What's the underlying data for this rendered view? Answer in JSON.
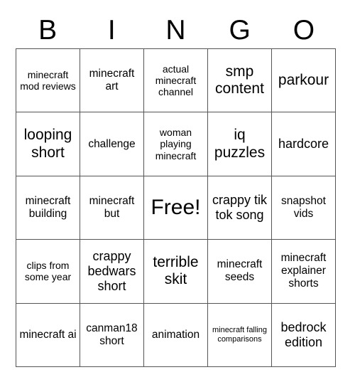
{
  "card": {
    "header_letters": [
      "B",
      "I",
      "N",
      "G",
      "O"
    ],
    "rows": [
      [
        {
          "text": "minecraft mod reviews",
          "size": "sm"
        },
        {
          "text": "minecraft art",
          "size": "md"
        },
        {
          "text": "actual minecraft channel",
          "size": "sm"
        },
        {
          "text": "smp content",
          "size": "xl"
        },
        {
          "text": "parkour",
          "size": "xl"
        }
      ],
      [
        {
          "text": "looping short",
          "size": "xl"
        },
        {
          "text": "challenge",
          "size": "md"
        },
        {
          "text": "woman playing minecraft",
          "size": "sm"
        },
        {
          "text": "iq puzzles",
          "size": "xl"
        },
        {
          "text": "hardcore",
          "size": "lg"
        }
      ],
      [
        {
          "text": "minecraft building",
          "size": "md"
        },
        {
          "text": "minecraft but",
          "size": "md"
        },
        {
          "text": "Free!",
          "size": "xxl"
        },
        {
          "text": "crappy tik tok song",
          "size": "lg"
        },
        {
          "text": "snapshot vids",
          "size": "md"
        }
      ],
      [
        {
          "text": "clips from some year",
          "size": "sm"
        },
        {
          "text": "crappy bedwars short",
          "size": "lg"
        },
        {
          "text": "terrible skit",
          "size": "xl"
        },
        {
          "text": "minecraft seeds",
          "size": "md"
        },
        {
          "text": "minecraft explainer shorts",
          "size": "md"
        }
      ],
      [
        {
          "text": "minecraft ai",
          "size": "md"
        },
        {
          "text": "canman18 short",
          "size": "md"
        },
        {
          "text": "animation",
          "size": "md"
        },
        {
          "text": "minecraft falling comparisons",
          "size": "xs"
        },
        {
          "text": "bedrock edition",
          "size": "lg"
        }
      ]
    ]
  },
  "colors": {
    "background": "#ffffff",
    "text": "#000000",
    "grid_line": "#555555"
  }
}
